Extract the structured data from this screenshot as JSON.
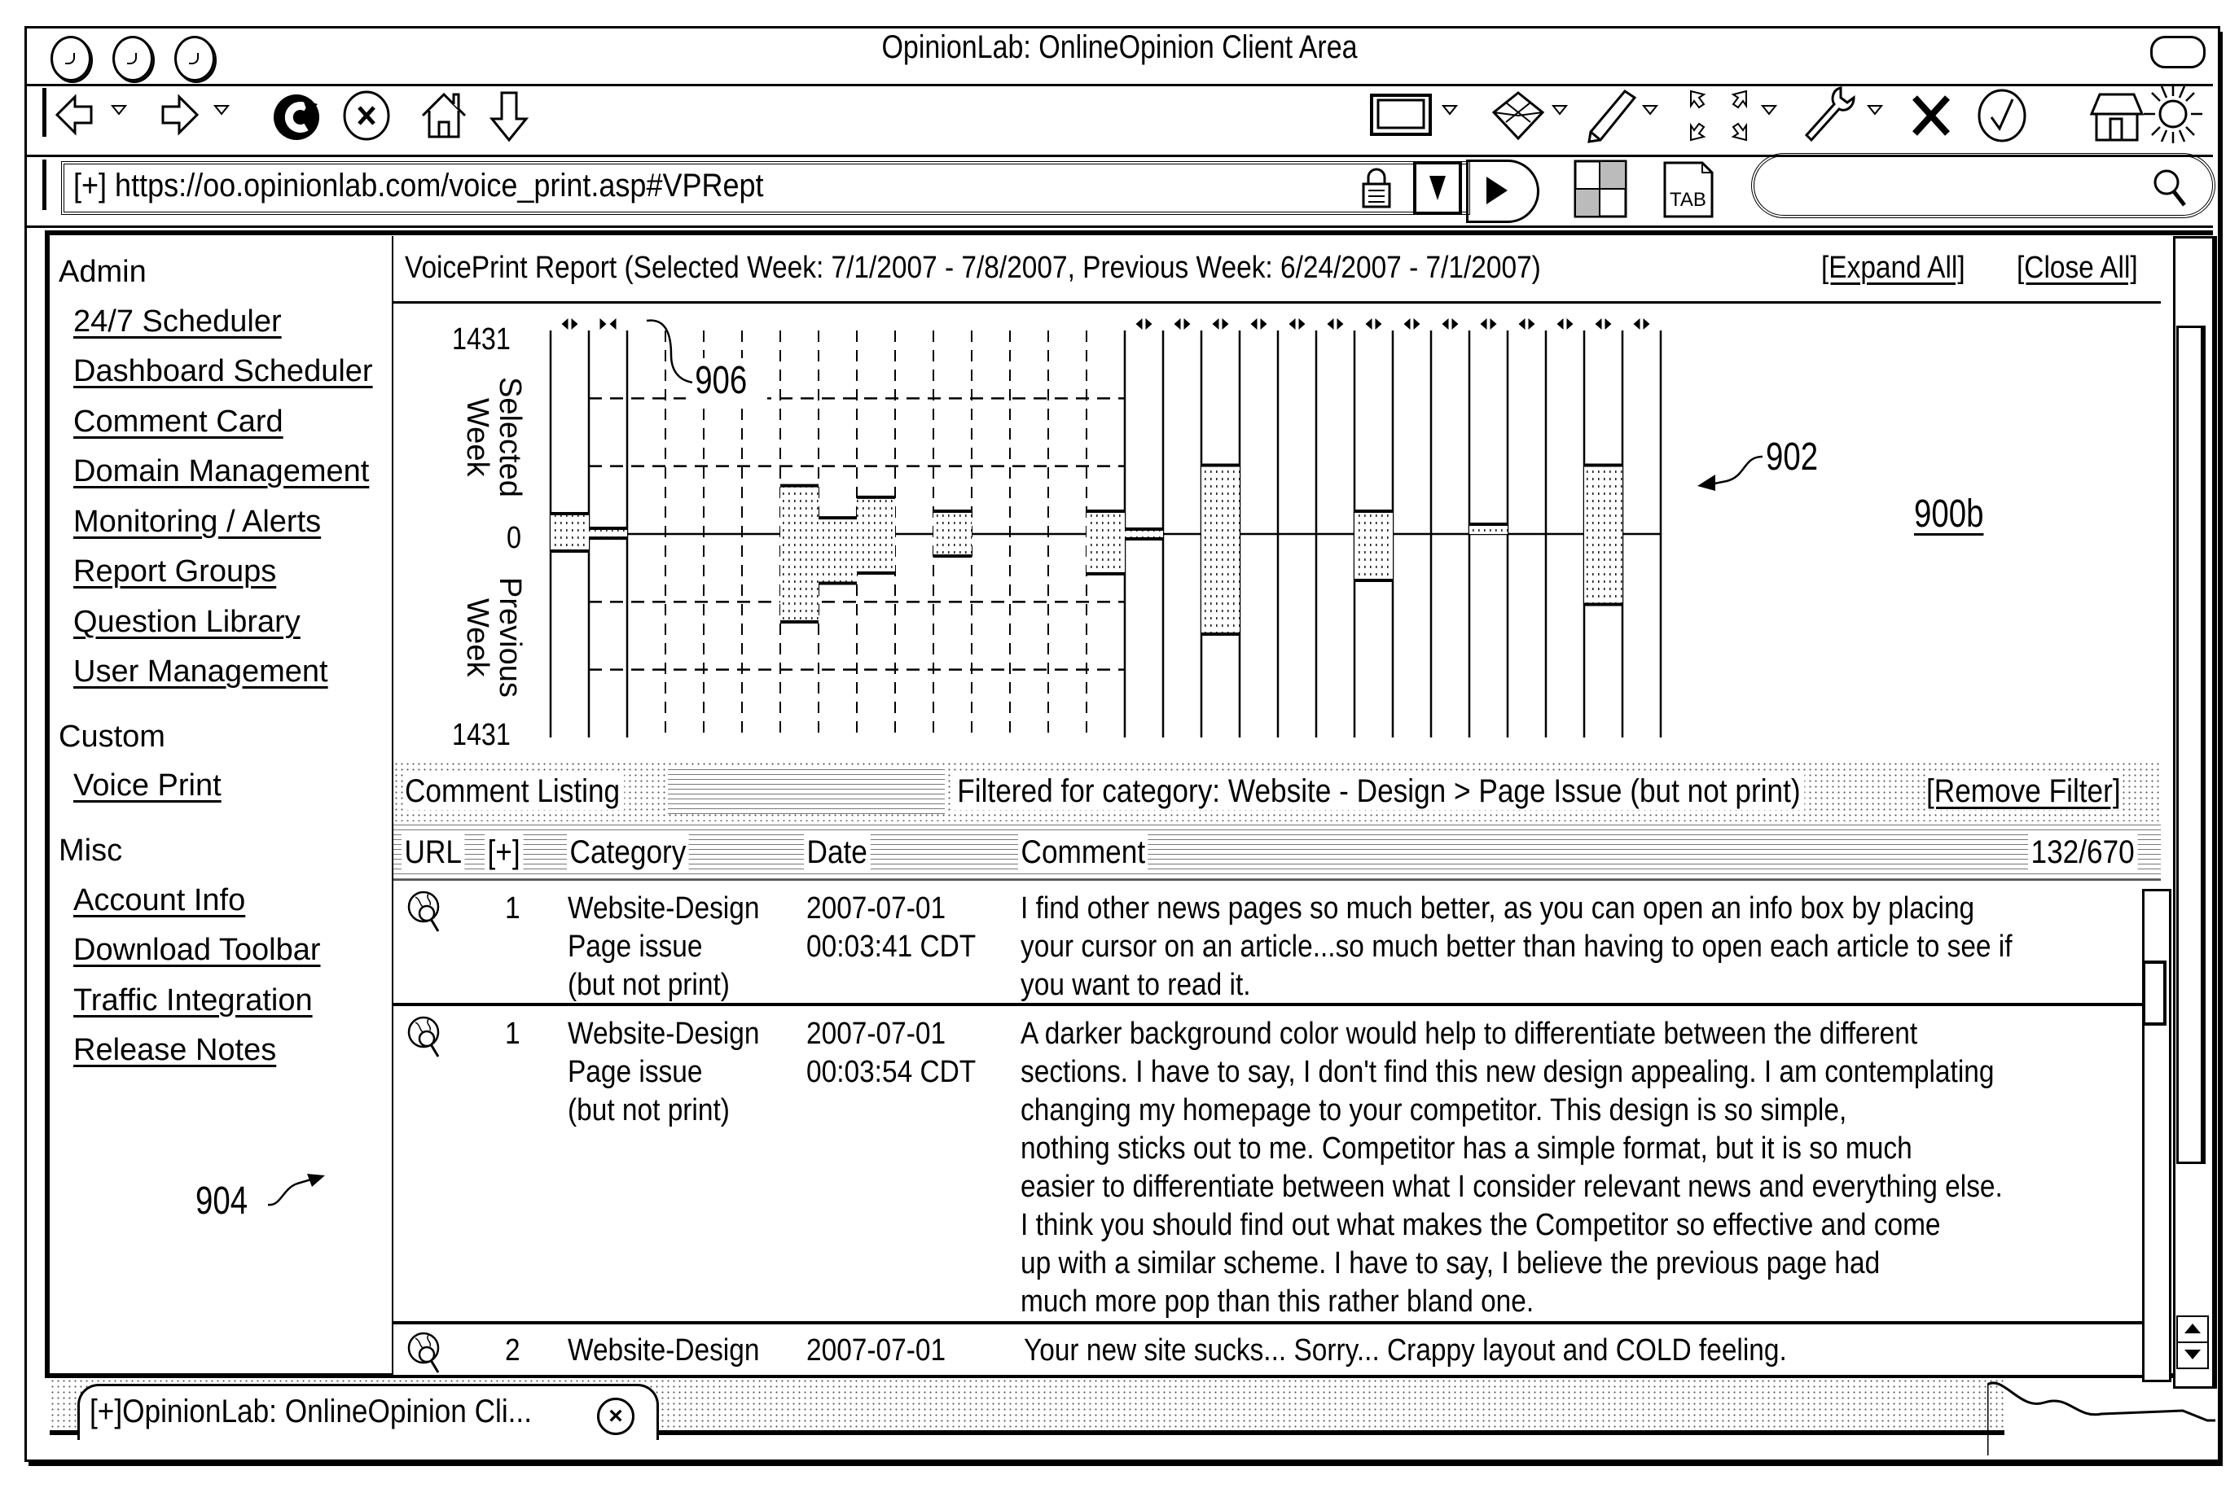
{
  "window": {
    "title": "OpinionLab: OnlineOpinion Client Area",
    "tab_label": "[+]OpinionLab: OnlineOpinion Cli...",
    "tab_close_glyph": "×"
  },
  "toolbar": {
    "left_icons": [
      "back-arrow-icon",
      "forward-arrow-icon",
      "reload-icon",
      "stop-icon",
      "home-icon",
      "download-arrow-icon"
    ],
    "right_icons": [
      "window-icon",
      "cube-icon",
      "pencil-icon",
      "expand-arrows-icon",
      "wrench-icon",
      "close-x-icon",
      "checkmark-icon",
      "house-icon",
      "sun-icon"
    ]
  },
  "address_bar": {
    "prefix": "[+]",
    "url": "https://oo.opinionlab.com/voice_print.asp#VPRept",
    "tab_button_label": "TAB",
    "search_placeholder": ""
  },
  "sidebar": {
    "sections": [
      {
        "heading": "Admin",
        "items": [
          "24/7 Scheduler",
          "Dashboard Scheduler",
          "Comment Card",
          "Domain Management",
          "Monitoring / Alerts",
          "Report Groups",
          "Question Library",
          "User Management"
        ]
      },
      {
        "heading": "Custom",
        "items": [
          "Voice Print"
        ]
      },
      {
        "heading": "Misc",
        "items": [
          "Account Info",
          "Download Toolbar",
          "Traffic Integration",
          "Release Notes"
        ]
      }
    ]
  },
  "report": {
    "title": "VoicePrint Report (Selected Week: 7/1/2007 - 7/8/2007, Previous Week: 6/24/2007 - 7/1/2007)",
    "expand_all": "[Expand All]",
    "close_all": "[Close All]"
  },
  "chart_data": {
    "type": "bar",
    "title": "VoicePrint Report",
    "subtitle": "Selected Week: 7/1/2007 - 7/8/2007, Previous Week: 6/24/2007 - 7/1/2007",
    "ylabel_top": "Selected Week",
    "ylabel_bottom": "Previous Week",
    "tick_labels": {
      "top": "1431",
      "zero": "0",
      "bottom": "1431"
    },
    "ylim": [
      -1431,
      1431
    ],
    "grid": true,
    "gridlines": [
      -954,
      -477,
      477,
      954
    ],
    "columns": [
      {
        "kind": "group",
        "state": "collapsed",
        "marker": "◂▸",
        "selected": 143,
        "previous": 120
      },
      {
        "kind": "group",
        "state": "expanded",
        "marker": "▸◂",
        "selected": 40,
        "previous": 29
      },
      {
        "kind": "sub",
        "selected": 0,
        "previous": 0
      },
      {
        "kind": "sub",
        "selected": 0,
        "previous": 0
      },
      {
        "kind": "sub",
        "selected": 0,
        "previous": 0
      },
      {
        "kind": "sub",
        "selected": 0,
        "previous": 0
      },
      {
        "kind": "sub",
        "selected": 340,
        "previous": 618
      },
      {
        "kind": "sub",
        "selected": 114,
        "previous": 346
      },
      {
        "kind": "sub",
        "selected": 258,
        "previous": 275
      },
      {
        "kind": "sub",
        "selected": 0,
        "previous": 0
      },
      {
        "kind": "sub",
        "selected": 160,
        "previous": 155
      },
      {
        "kind": "sub",
        "selected": 0,
        "previous": 0
      },
      {
        "kind": "sub",
        "selected": 0,
        "previous": 0
      },
      {
        "kind": "sub",
        "selected": 0,
        "previous": 0
      },
      {
        "kind": "sub",
        "selected": 160,
        "previous": 280
      },
      {
        "kind": "group",
        "state": "collapsed",
        "marker": "◂▸",
        "selected": 34,
        "previous": 34
      },
      {
        "kind": "group",
        "state": "collapsed",
        "marker": "◂▸",
        "selected": 0,
        "previous": 0
      },
      {
        "kind": "group",
        "state": "collapsed",
        "marker": "◂▸",
        "selected": 484,
        "previous": 704
      },
      {
        "kind": "group",
        "state": "collapsed",
        "marker": "◂▸",
        "selected": 0,
        "previous": 0
      },
      {
        "kind": "group",
        "state": "collapsed",
        "marker": "◂▸",
        "selected": 0,
        "previous": 0
      },
      {
        "kind": "group",
        "state": "collapsed",
        "marker": "◂▸",
        "selected": 0,
        "previous": 0
      },
      {
        "kind": "group",
        "state": "collapsed",
        "marker": "◂▸",
        "selected": 160,
        "previous": 326
      },
      {
        "kind": "group",
        "state": "collapsed",
        "marker": "◂▸",
        "selected": 0,
        "previous": 0
      },
      {
        "kind": "group",
        "state": "collapsed",
        "marker": "◂▸",
        "selected": 0,
        "previous": 0
      },
      {
        "kind": "group",
        "state": "collapsed",
        "marker": "◂▸",
        "selected": 69,
        "previous": 0
      },
      {
        "kind": "group",
        "state": "collapsed",
        "marker": "◂▸",
        "selected": 0,
        "previous": 0
      },
      {
        "kind": "group",
        "state": "collapsed",
        "marker": "◂▸",
        "selected": 0,
        "previous": 0
      },
      {
        "kind": "group",
        "state": "collapsed",
        "marker": "◂▸",
        "selected": 484,
        "previous": 495
      },
      {
        "kind": "group",
        "state": "collapsed",
        "marker": "◂▸",
        "selected": 0,
        "previous": 0
      }
    ],
    "annotations": [
      "906",
      "902",
      "900b",
      "904"
    ]
  },
  "listing": {
    "title": "Comment Listing",
    "filter_text": "Filtered for category: Website - Design > Page Issue (but not print)",
    "remove_filter": "[Remove Filter]",
    "columns": {
      "url": "URL",
      "expand": "[+]",
      "category": "Category",
      "date": "Date",
      "comment": "Comment"
    },
    "count": "132/670",
    "rows": [
      {
        "count": "1",
        "category": [
          "Website-Design",
          "Page issue",
          "(but not print)"
        ],
        "date": [
          "2007-07-01",
          "00:03:41 CDT"
        ],
        "comment": "I find other news pages so much better, as you can open an info box by placing\nyour cursor on an article...so much better than having to open each article to see if\nyou want to read it."
      },
      {
        "count": "1",
        "category": [
          "Website-Design",
          "Page issue",
          "(but not print)"
        ],
        "date": [
          "2007-07-01",
          "00:03:54 CDT"
        ],
        "comment": "A darker background color would help to differentiate between the different\nsections. I have to say, I don't find this new design appealing. I am contemplating\nchanging my homepage to your competitor. This design is so simple,\nnothing sticks out to me. Competitor has a simple format, but it is so much\neasier to differentiate between what I consider relevant news and everything else.\nI think you should find out what makes the Competitor so effective and come\nup with a similar scheme. I have to say, I believe the previous page had\nmuch more pop than this rather bland one."
      },
      {
        "count": "2",
        "category": [
          "Website-Design"
        ],
        "date": [
          "2007-07-01"
        ],
        "comment": "Your new site sucks... Sorry... Crappy layout and COLD feeling."
      }
    ]
  },
  "annotations": {
    "chart_ref": "906",
    "graph_ref": "902",
    "figure_ref": "900b",
    "sidebar_ref": "904"
  }
}
